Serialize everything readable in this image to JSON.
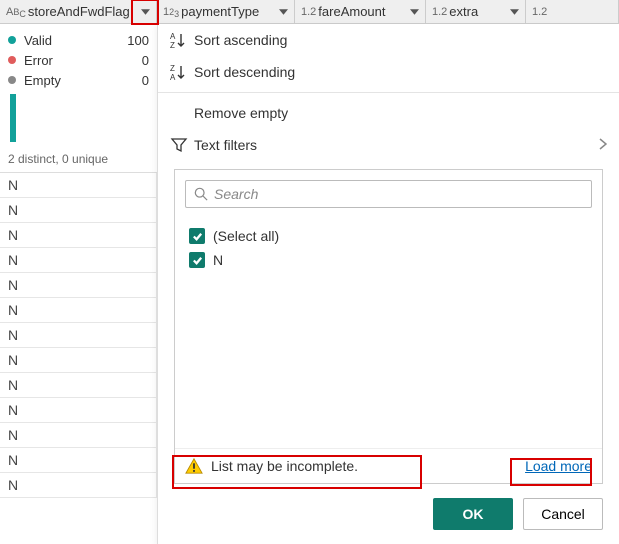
{
  "columns": [
    {
      "type_prefix": "ABC",
      "name": "storeAndFwdFlag"
    },
    {
      "type_prefix": "123",
      "name": "paymentType"
    },
    {
      "type_prefix": "1.2",
      "name": "fareAmount"
    },
    {
      "type_prefix": "1.2",
      "name": "extra"
    },
    {
      "type_prefix": "1.2",
      "name": ""
    }
  ],
  "stats": {
    "valid_label": "Valid",
    "valid_value": "100",
    "error_label": "Error",
    "error_value": "0",
    "empty_label": "Empty",
    "empty_value": "0",
    "distinct_line": "2 distinct, 0 unique"
  },
  "rows": [
    "N",
    "N",
    "N",
    "N",
    "N",
    "N",
    "N",
    "N",
    "N",
    "N",
    "N",
    "N",
    "N"
  ],
  "menu": {
    "sort_asc": "Sort ascending",
    "sort_desc": "Sort descending",
    "remove_empty": "Remove empty",
    "text_filters": "Text filters"
  },
  "search": {
    "placeholder": "Search"
  },
  "values": {
    "select_all": "(Select all)",
    "items": [
      "N"
    ]
  },
  "incomplete": {
    "message": "List may be incomplete.",
    "load_more": "Load more"
  },
  "buttons": {
    "ok": "OK",
    "cancel": "Cancel"
  }
}
